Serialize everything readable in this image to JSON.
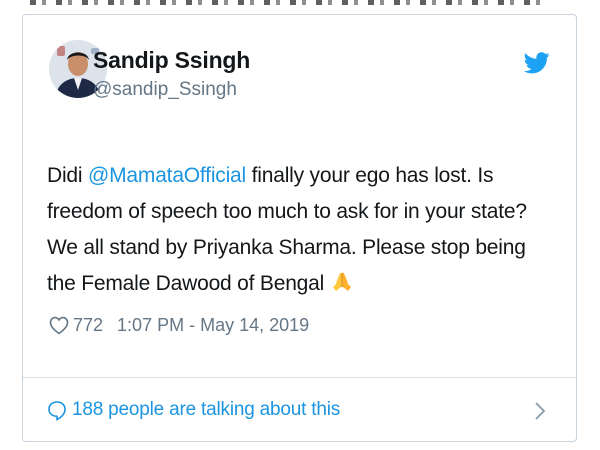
{
  "tweet": {
    "author_name": "Sandip Ssingh",
    "author_handle": "@sandip_Ssingh",
    "text_before_mention": "Didi ",
    "mention": "@MamataOfficial",
    "text_after_mention": " finally your ego has lost. Is freedom of speech too much to ask for in your state? We all stand by Priyanka Sharma. Please stop being the Female Dawood of Bengal ",
    "emoji": "folded-hands-emoji",
    "likes": "772",
    "timestamp": "1:07 PM - May 14, 2019",
    "talking": "188 people are talking about this"
  },
  "icons": {
    "brand": "twitter-bird-icon",
    "like": "heart-icon",
    "reply": "speech-bubble-icon",
    "more": "chevron-right-icon"
  },
  "colors": {
    "link": "#1b95e0",
    "text": "#14171a",
    "muted": "#657786",
    "border": "#c9d3dc"
  }
}
